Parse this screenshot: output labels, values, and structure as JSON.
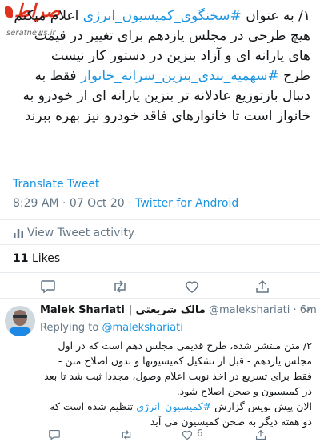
{
  "watermark": {
    "logo": "صراط",
    "site": "seratnews.ir"
  },
  "tweet": {
    "text_parts": [
      "۱/ به عنوان ",
      "#سخنگوی_کمیسیون_انرژی",
      " اعلام میکنم هیچ طرحی در مجلس یازدهم برای تغییر در قیمت های یارانه ای و آزاد بنزین در دستور کار نیست",
      "طرح ",
      "#سهمیه_بندی_بنزین_سرانه_خانوار",
      " فقط به دنبال بازتوزیع عادلانه تر بنزین یارانه ای از خودرو به خانوار است تا خانوارهای فاقد خودرو نیز بهره ببرند"
    ],
    "translate_label": "Translate Tweet",
    "time": "8:29 AM",
    "sep1": " · ",
    "date": "07 Oct 20",
    "sep2": " · ",
    "client": "Twitter for Android",
    "activity_label": "View Tweet activity",
    "likes_count": "11",
    "likes_label": "Likes"
  },
  "reply": {
    "name": "Malek Shariati | مالک شریعتی",
    "handle": "@malekshariati",
    "dot": " · ",
    "time": "6m",
    "replying_prefix": "Replying to ",
    "replying_to": "@malekshariati",
    "text_parts": [
      "۲/ متن منتشر شده، طرح قدیمی مجلس دهم است که در اول مجلس یازدهم - قبل از تشکیل کمیسیونها و بدون اصلاح متن - فقط برای تسریع در اخذ نوبت اعلام وصول، مجددا ثبت شد تا بعد در کمیسیون و صحن اصلاح شود.",
      "الان پیش نویس گزارش ",
      "#کمیسیون_انرژی",
      " تنظیم شده است که دو هفته دیگر به صحن کمیسیون می آید"
    ],
    "like_count": "6"
  },
  "colors": {
    "accent": "#1b95e0",
    "muted": "#657786",
    "watermark": "#e0321f"
  }
}
